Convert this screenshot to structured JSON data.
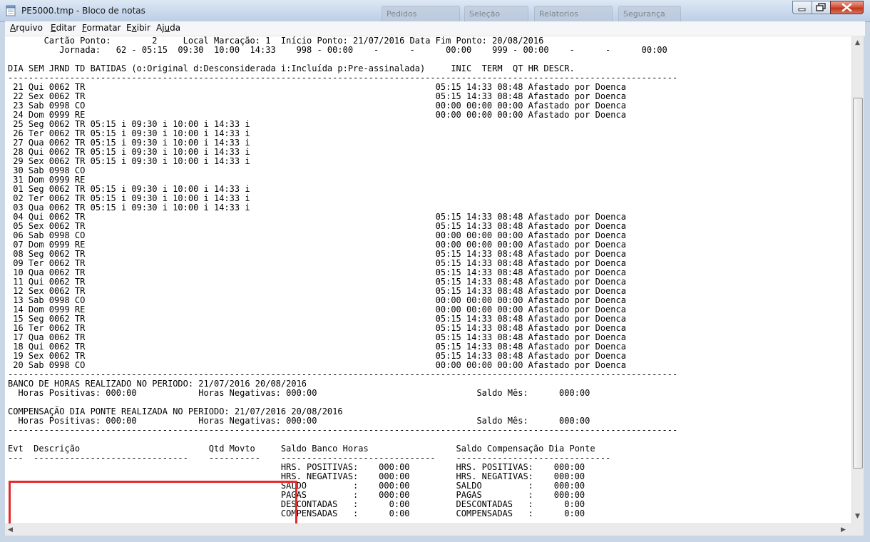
{
  "window": {
    "title": "PE5000.tmp - Bloco de notas",
    "background_tabs": [
      "Pedidos",
      "Seleção",
      "Relatorios",
      "Segurança"
    ]
  },
  "menu": [
    {
      "label": "Arquivo",
      "accel": "A"
    },
    {
      "label": "Editar",
      "accel": "E"
    },
    {
      "label": "Formatar",
      "accel": "F"
    },
    {
      "label": "Exibir",
      "accel": "x"
    },
    {
      "label": "Ajuda",
      "accel": "u"
    }
  ],
  "document": {
    "header_lines": [
      "       Cartão Ponto:        2     Local Marcação: 1  Início Ponto: 21/07/2016 Data Fim Ponto: 20/08/2016",
      "          Jornada:   62 - 05:15  09:30  10:00  14:33    998 - 00:00    -      -      00:00    999 - 00:00    -      -      00:00",
      "",
      "DIA SEM JRND TD BATIDAS (o:Original d:Desconsiderada i:Incluída p:Pre-assinalada)     INIC  TERM  QT HR DESCR.",
      "----------------------------------------------------------------------------------------------------------------------------------"
    ],
    "rows": [
      " 21 Qui 0062 TR                                                                    05:15 14:33 08:48 Afastado por Doenca",
      " 22 Sex 0062 TR                                                                    05:15 14:33 08:48 Afastado por Doenca",
      " 23 Sab 0998 CO                                                                    00:00 00:00 00:00 Afastado por Doenca",
      " 24 Dom 0999 RE                                                                    00:00 00:00 00:00 Afastado por Doenca",
      " 25 Seg 0062 TR 05:15 i 09:30 i 10:00 i 14:33 i",
      " 26 Ter 0062 TR 05:15 i 09:30 i 10:00 i 14:33 i",
      " 27 Qua 0062 TR 05:15 i 09:30 i 10:00 i 14:33 i",
      " 28 Qui 0062 TR 05:15 i 09:30 i 10:00 i 14:33 i",
      " 29 Sex 0062 TR 05:15 i 09:30 i 10:00 i 14:33 i",
      " 30 Sab 0998 CO",
      " 31 Dom 0999 RE",
      " 01 Seg 0062 TR 05:15 i 09:30 i 10:00 i 14:33 i",
      " 02 Ter 0062 TR 05:15 i 09:30 i 10:00 i 14:33 i",
      " 03 Qua 0062 TR 05:15 i 09:30 i 10:00 i 14:33 i",
      " 04 Qui 0062 TR                                                                    05:15 14:33 08:48 Afastado por Doenca",
      " 05 Sex 0062 TR                                                                    05:15 14:33 08:48 Afastado por Doenca",
      " 06 Sab 0998 CO                                                                    00:00 00:00 00:00 Afastado por Doenca",
      " 07 Dom 0999 RE                                                                    00:00 00:00 00:00 Afastado por Doenca",
      " 08 Seg 0062 TR                                                                    05:15 14:33 08:48 Afastado por Doenca",
      " 09 Ter 0062 TR                                                                    05:15 14:33 08:48 Afastado por Doenca",
      " 10 Qua 0062 TR                                                                    05:15 14:33 08:48 Afastado por Doenca",
      " 11 Qui 0062 TR                                                                    05:15 14:33 08:48 Afastado por Doenca",
      " 12 Sex 0062 TR                                                                    05:15 14:33 08:48 Afastado por Doenca",
      " 13 Sab 0998 CO                                                                    00:00 00:00 00:00 Afastado por Doenca",
      " 14 Dom 0999 RE                                                                    00:00 00:00 00:00 Afastado por Doenca",
      " 15 Seg 0062 TR                                                                    05:15 14:33 08:48 Afastado por Doenca",
      " 16 Ter 0062 TR                                                                    05:15 14:33 08:48 Afastado por Doenca",
      " 17 Qua 0062 TR                                                                    05:15 14:33 08:48 Afastado por Doenca",
      " 18 Qui 0062 TR                                                                    05:15 14:33 08:48 Afastado por Doenca",
      " 19 Sex 0062 TR                                                                    05:15 14:33 08:48 Afastado por Doenca",
      " 20 Sab 0998 CO                                                                    00:00 00:00 00:00 Afastado por Doenca"
    ],
    "footer_lines": [
      "----------------------------------------------------------------------------------------------------------------------------------",
      "BANCO DE HORAS REALIZADO NO PERIODO: 21/07/2016 20/08/2016",
      "  Horas Positivas: 000:00            Horas Negativas: 000:00                               Saldo Mês:      000:00",
      "",
      "COMPENSAÇÃO DIA PONTE REALIZADA NO PERIODO: 21/07/2016 20/08/2016",
      "  Horas Positivas: 000:00            Horas Negativas: 000:00                               Saldo Mês:      000:00",
      "----------------------------------------------------------------------------------------------------------------------------------",
      "",
      "Evt  Descrição                         Qtd Movto     Saldo Banco Horas                 Saldo Compensação Dia Ponte",
      "---  ------------------------------    ----------    ------------------------------    ------------------------------",
      "                                                     HRS. POSITIVAS:    000:00         HRS. POSITIVAS:    000:00",
      "                                                     HRS. NEGATIVAS:    000:00         HRS. NEGATIVAS:    000:00",
      "                                                     SALDO         :    000:00         SALDO         :    000:00",
      "                                                     PAGAS         :    000:00         PAGAS         :    000:00",
      "                                                     DESCONTADAS   :      0:00         DESCONTADAS   :      0:00",
      "                                                     COMPENSADAS   :      0:00         COMPENSADAS   :      0:00"
    ]
  },
  "colors": {
    "highlight_box": "#e32b2b",
    "close_button": "#c2361b"
  }
}
